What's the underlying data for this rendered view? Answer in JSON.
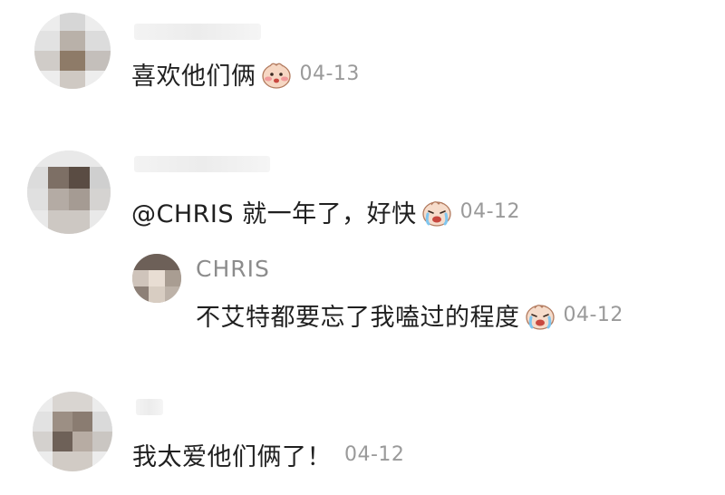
{
  "comments": [
    {
      "text": "喜欢他们俩",
      "emoji": "shy-face-emoji",
      "date": "04-13"
    },
    {
      "text": "@CHRIS 就一年了，好快",
      "emoji": "crying-face-emoji",
      "date": "04-12",
      "reply": {
        "author": "CHRIS",
        "text": "不艾特都要忘了我嗑过的程度",
        "emoji": "crying-face-emoji",
        "date": "04-12"
      }
    },
    {
      "text": "我太爱他们俩了！",
      "date": "04-12"
    }
  ]
}
